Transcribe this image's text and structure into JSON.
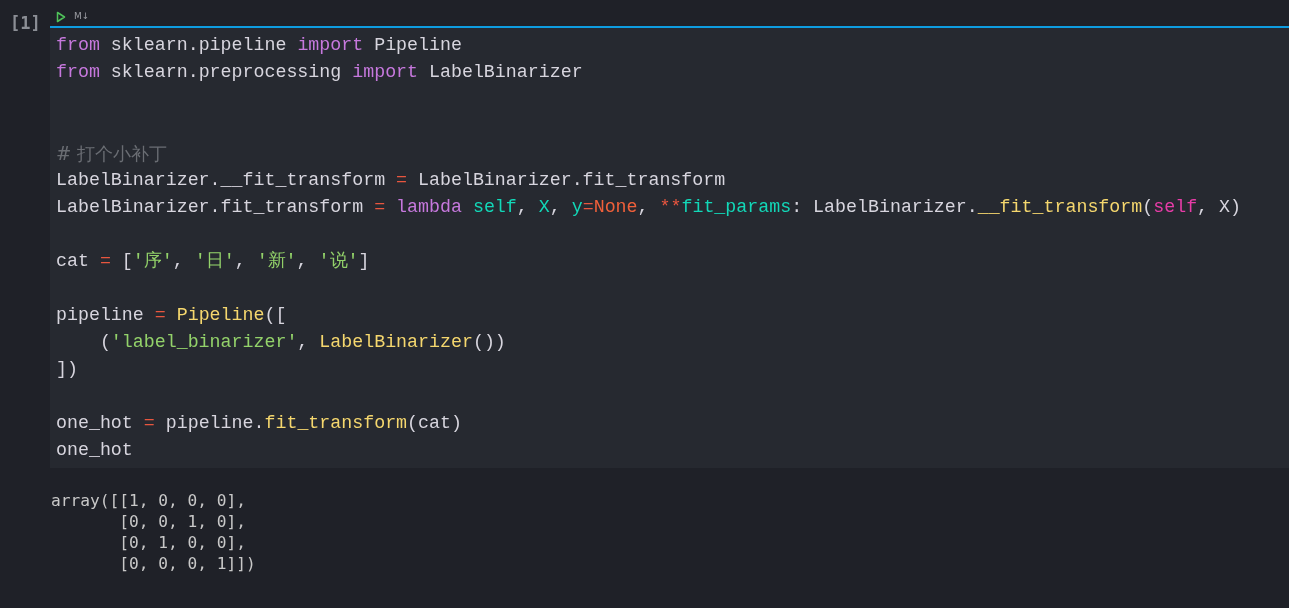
{
  "cell": {
    "execution_count": "[1]",
    "toolbar": {
      "language_label": "M↓"
    },
    "code_lines": [
      {
        "kind": "code",
        "tokens": [
          {
            "kind": "kw",
            "text": "from"
          },
          {
            "kind": "plain",
            "text": " sklearn.pipeline "
          },
          {
            "kind": "kw",
            "text": "import"
          },
          {
            "kind": "plain",
            "text": " Pipeline"
          }
        ]
      },
      {
        "kind": "code",
        "tokens": [
          {
            "kind": "kw",
            "text": "from"
          },
          {
            "kind": "plain",
            "text": " sklearn.preprocessing "
          },
          {
            "kind": "kw",
            "text": "import"
          },
          {
            "kind": "plain",
            "text": " LabelBinarizer"
          }
        ]
      },
      {
        "kind": "blank"
      },
      {
        "kind": "blank"
      },
      {
        "kind": "code",
        "tokens": [
          {
            "kind": "comment",
            "text": "# 打个小补丁"
          }
        ]
      },
      {
        "kind": "code",
        "tokens": [
          {
            "kind": "plain",
            "text": "LabelBinarizer.__fit_transform "
          },
          {
            "kind": "op",
            "text": "="
          },
          {
            "kind": "plain",
            "text": " LabelBinarizer.fit_transform"
          }
        ]
      },
      {
        "kind": "code",
        "tokens": [
          {
            "kind": "plain",
            "text": "LabelBinarizer.fit_transform "
          },
          {
            "kind": "op",
            "text": "="
          },
          {
            "kind": "kw",
            "text": " lambda"
          },
          {
            "kind": "param",
            "text": " self"
          },
          {
            "kind": "plain",
            "text": ", "
          },
          {
            "kind": "param",
            "text": "X"
          },
          {
            "kind": "plain",
            "text": ", "
          },
          {
            "kind": "param",
            "text": "y"
          },
          {
            "kind": "op",
            "text": "="
          },
          {
            "kind": "const",
            "text": "None"
          },
          {
            "kind": "plain",
            "text": ", "
          },
          {
            "kind": "op",
            "text": "**"
          },
          {
            "kind": "param",
            "text": "fit_params"
          },
          {
            "kind": "plain",
            "text": ": LabelBinarizer."
          },
          {
            "kind": "fn",
            "text": "__fit_transform"
          },
          {
            "kind": "plain",
            "text": "("
          },
          {
            "kind": "self",
            "text": "self"
          },
          {
            "kind": "plain",
            "text": ", X)"
          }
        ]
      },
      {
        "kind": "blank"
      },
      {
        "kind": "code",
        "tokens": [
          {
            "kind": "plain",
            "text": "cat "
          },
          {
            "kind": "op",
            "text": "="
          },
          {
            "kind": "plain",
            "text": " ["
          },
          {
            "kind": "str",
            "text": "'序'"
          },
          {
            "kind": "plain",
            "text": ", "
          },
          {
            "kind": "str",
            "text": "'日'"
          },
          {
            "kind": "plain",
            "text": ", "
          },
          {
            "kind": "str",
            "text": "'新'"
          },
          {
            "kind": "plain",
            "text": ", "
          },
          {
            "kind": "str",
            "text": "'说'"
          },
          {
            "kind": "plain",
            "text": "]"
          }
        ]
      },
      {
        "kind": "blank"
      },
      {
        "kind": "code",
        "tokens": [
          {
            "kind": "plain",
            "text": "pipeline "
          },
          {
            "kind": "op",
            "text": "="
          },
          {
            "kind": "fn",
            "text": " Pipeline"
          },
          {
            "kind": "plain",
            "text": "(["
          }
        ]
      },
      {
        "kind": "code",
        "tokens": [
          {
            "kind": "plain",
            "text": "    ("
          },
          {
            "kind": "str",
            "text": "'label_binarizer'"
          },
          {
            "kind": "plain",
            "text": ", "
          },
          {
            "kind": "fn",
            "text": "LabelBinarizer"
          },
          {
            "kind": "plain",
            "text": "())"
          }
        ]
      },
      {
        "kind": "code",
        "tokens": [
          {
            "kind": "plain",
            "text": "])"
          }
        ]
      },
      {
        "kind": "blank"
      },
      {
        "kind": "code",
        "tokens": [
          {
            "kind": "plain",
            "text": "one_hot "
          },
          {
            "kind": "op",
            "text": "="
          },
          {
            "kind": "plain",
            "text": " pipeline."
          },
          {
            "kind": "fn",
            "text": "fit_transform"
          },
          {
            "kind": "plain",
            "text": "(cat)"
          }
        ]
      },
      {
        "kind": "code",
        "tokens": [
          {
            "kind": "plain",
            "text": "one_hot"
          }
        ]
      }
    ],
    "output_lines": [
      "array([[1, 0, 0, 0],",
      "       [0, 0, 1, 0],",
      "       [0, 1, 0, 0],",
      "       [0, 0, 0, 1]])"
    ]
  }
}
